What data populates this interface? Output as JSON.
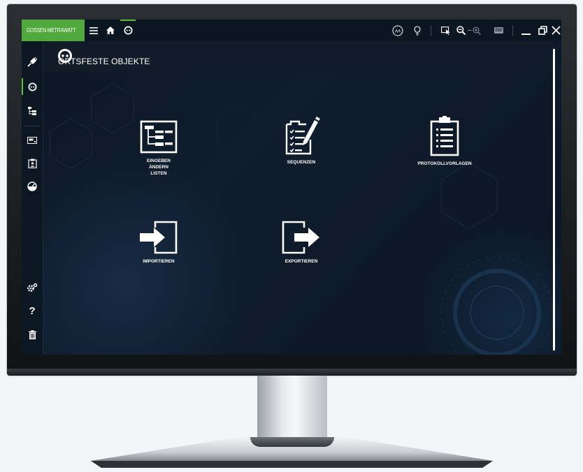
{
  "app": {
    "brand": "GOSSEN METRAWATT",
    "brand_color": "#51a83c",
    "accent": "#5fbf3a"
  },
  "topbar": {
    "left_icons": [
      "hamburger-icon",
      "home-icon",
      "socket-icon"
    ],
    "right_icons": [
      "aa-text-size-icon",
      "lightbulb-icon",
      "pointer-select-icon",
      "zoom-out-icon",
      "zoom-in-icon",
      "keyboard-icon",
      "minimize-icon",
      "restore-icon",
      "close-icon"
    ],
    "aa_label": "AA"
  },
  "sidebar": {
    "items": [
      {
        "icon": "plug-icon"
      },
      {
        "icon": "socket-icon",
        "active": true
      },
      {
        "icon": "tree-icon"
      },
      {
        "icon": "device-icon"
      },
      {
        "icon": "clipboard-person-icon"
      },
      {
        "icon": "gauge-icon"
      },
      {
        "icon": "settings-icon"
      },
      {
        "icon": "help-icon",
        "label": "?"
      },
      {
        "icon": "trash-icon"
      }
    ]
  },
  "header": {
    "title": "ORTSFESTE OBJEKTE"
  },
  "tiles": [
    {
      "label": "EINGEBEN\nÄNDERN\nLISTEN",
      "icon": "tree-list-icon"
    },
    {
      "label": "SEQUENZEN",
      "icon": "checklist-pen-icon"
    },
    {
      "label": "PROTOKOLLVORLAGEN",
      "icon": "clipboard-list-icon"
    },
    {
      "label": "IMPORTIEREN",
      "icon": "import-icon"
    },
    {
      "label": "EXPORTIEREN",
      "icon": "export-icon"
    }
  ]
}
